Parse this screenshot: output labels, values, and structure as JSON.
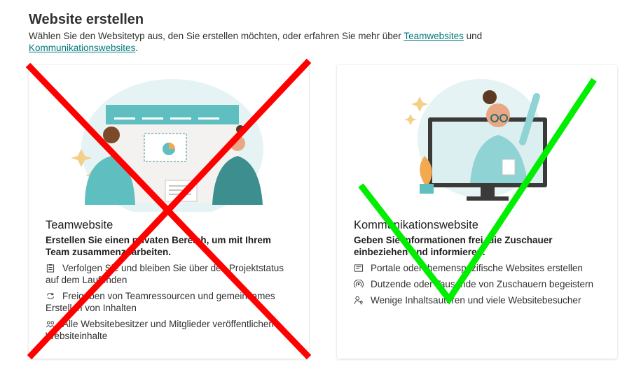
{
  "header": {
    "title": "Website erstellen",
    "intro_text": "Wählen Sie den Websitetyp aus, den Sie erstellen möchten, oder erfahren Sie mehr über ",
    "link_team": "Teamwebsites",
    "and_text": " und ",
    "link_comm": "Kommunikationswebsites",
    "end_text": "."
  },
  "cards": [
    {
      "title": "Teamwebsite",
      "subtitle": "Erstellen Sie einen privaten Bereich, um mit Ihrem Team zusammenzuarbeiten.",
      "features": [
        {
          "icon": "clipboard-icon",
          "text": "Verfolgen Sie und bleiben Sie über den Projektstatus auf dem Laufenden"
        },
        {
          "icon": "sync-icon",
          "text": "Freigeben von Teamressourcen und gemeinsames Erstellen von Inhalten"
        },
        {
          "icon": "people-icon",
          "text": "Alle Websitebesitzer und Mitglieder veröffentlichen Websiteinhalte"
        }
      ]
    },
    {
      "title": "Kommunikationswebsite",
      "subtitle": "Geben Sie Informationen frei, die Zuschauer einbeziehen und informieren.",
      "features": [
        {
          "icon": "news-icon",
          "text": "Portale oder themenspezifische Websites erstellen"
        },
        {
          "icon": "broadcast-icon",
          "text": "Dutzende oder Tausende von Zuschauern begeistern"
        },
        {
          "icon": "person-key-icon",
          "text": "Wenige Inhaltsautoren und viele Websitebesucher"
        }
      ]
    }
  ],
  "colors": {
    "accent": "#03787c",
    "cross": "#ff0000",
    "check": "#00ee00"
  }
}
